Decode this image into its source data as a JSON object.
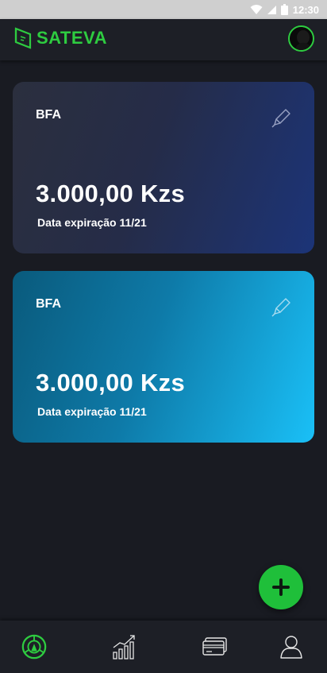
{
  "status_bar": {
    "time": "12:30",
    "icons": [
      "wifi-icon",
      "signal-icon",
      "battery-icon"
    ]
  },
  "app_bar": {
    "logo_text": "SATEVA",
    "avatar": "user-avatar"
  },
  "cards": [
    {
      "bank": "BFA",
      "amount": "3.000,00 Kzs",
      "expiry": "Data expiração 11/21",
      "edit_icon": "pencil-icon"
    },
    {
      "bank": "BFA",
      "amount": "3.000,00 Kzs",
      "expiry": "Data expiração 11/21",
      "edit_icon": "pencil-icon"
    }
  ],
  "fab": {
    "icon": "plus-icon"
  },
  "bottom_nav": [
    {
      "icon": "home-logo-icon",
      "active": true
    },
    {
      "icon": "chart-icon",
      "active": false
    },
    {
      "icon": "card-icon",
      "active": false
    },
    {
      "icon": "profile-icon",
      "active": false
    }
  ],
  "colors": {
    "accent": "#2ecc40",
    "background": "#191b22",
    "card_dark_end": "#1c3478",
    "card_light_end": "#1ac0f7"
  }
}
